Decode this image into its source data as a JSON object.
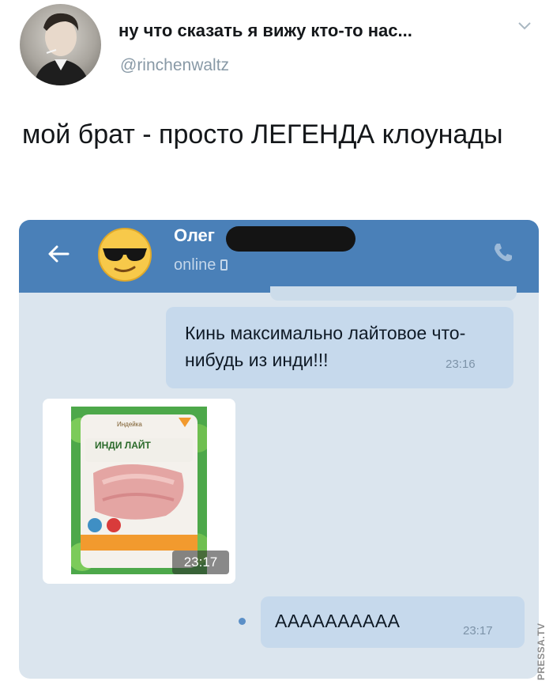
{
  "tweet": {
    "display_name": "ну что сказать я вижу кто-то нас...",
    "handle": "@rinchenwaltz",
    "text": "мой брат - просто ЛЕГЕНДА клоунады"
  },
  "chat": {
    "contact_name": "Олег",
    "status": "online",
    "messages": [
      {
        "direction": "out",
        "text": "Кинь максимально лайтовое что-нибудь из инди!!!",
        "time": "23:16"
      },
      {
        "direction": "in",
        "type": "photo",
        "product_brand": "Индейка",
        "product_label": "ИНДИ ЛАЙТ",
        "time": "23:17"
      },
      {
        "direction": "out",
        "text": "АААААААААА",
        "time": "23:17"
      }
    ]
  },
  "icons": {
    "back": "arrow-left-icon",
    "call": "phone-icon",
    "menu": "chevron-down-icon",
    "device": "mobile-device-icon"
  },
  "colors": {
    "header": "#4a80b8",
    "chat_bg": "#dbe5ee",
    "outgoing_bubble": "#c6d9ec",
    "handle": "#8899a6"
  },
  "watermark": "PRESSA.TV"
}
